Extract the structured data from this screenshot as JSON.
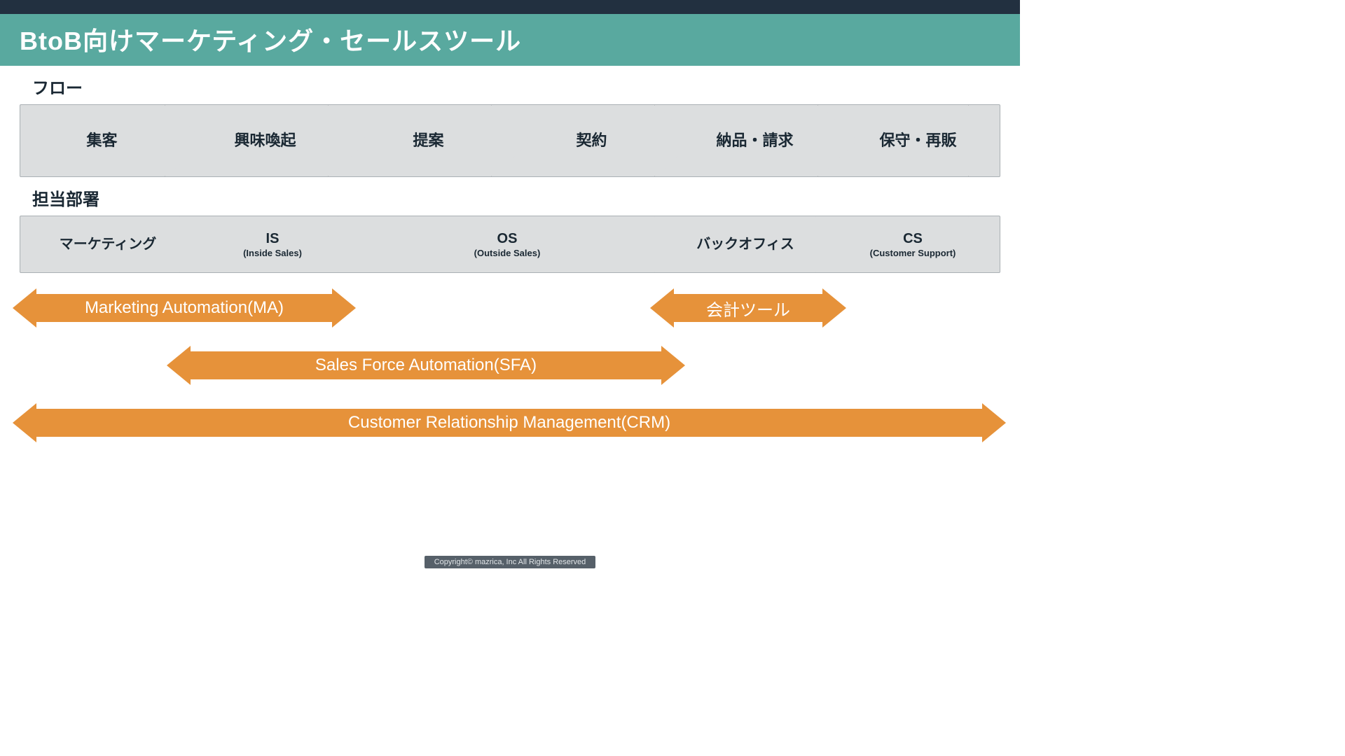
{
  "title": "BtoB向けマーケティング・セールスツール",
  "flow": {
    "label": "フロー",
    "stages": [
      "集客",
      "興味喚起",
      "提案",
      "契約",
      "納品・請求",
      "保守・再販"
    ]
  },
  "dept": {
    "label": "担当部署",
    "items": [
      {
        "main": "マーケティング",
        "sub": ""
      },
      {
        "main": "IS",
        "sub": "(Inside Sales)"
      },
      {
        "main": "OS",
        "sub": "(Outside Sales)"
      },
      {
        "main": "バックオフィス",
        "sub": ""
      },
      {
        "main": "CS",
        "sub": "(Customer Support)"
      }
    ]
  },
  "tools": {
    "ma": "Marketing Automation(MA)",
    "acc": "会計ツール",
    "sfa": "Sales Force Automation(SFA)",
    "crm": "Customer Relationship Management(CRM)"
  },
  "footer": "Copyright© mazrica, Inc All Rights Reserved"
}
